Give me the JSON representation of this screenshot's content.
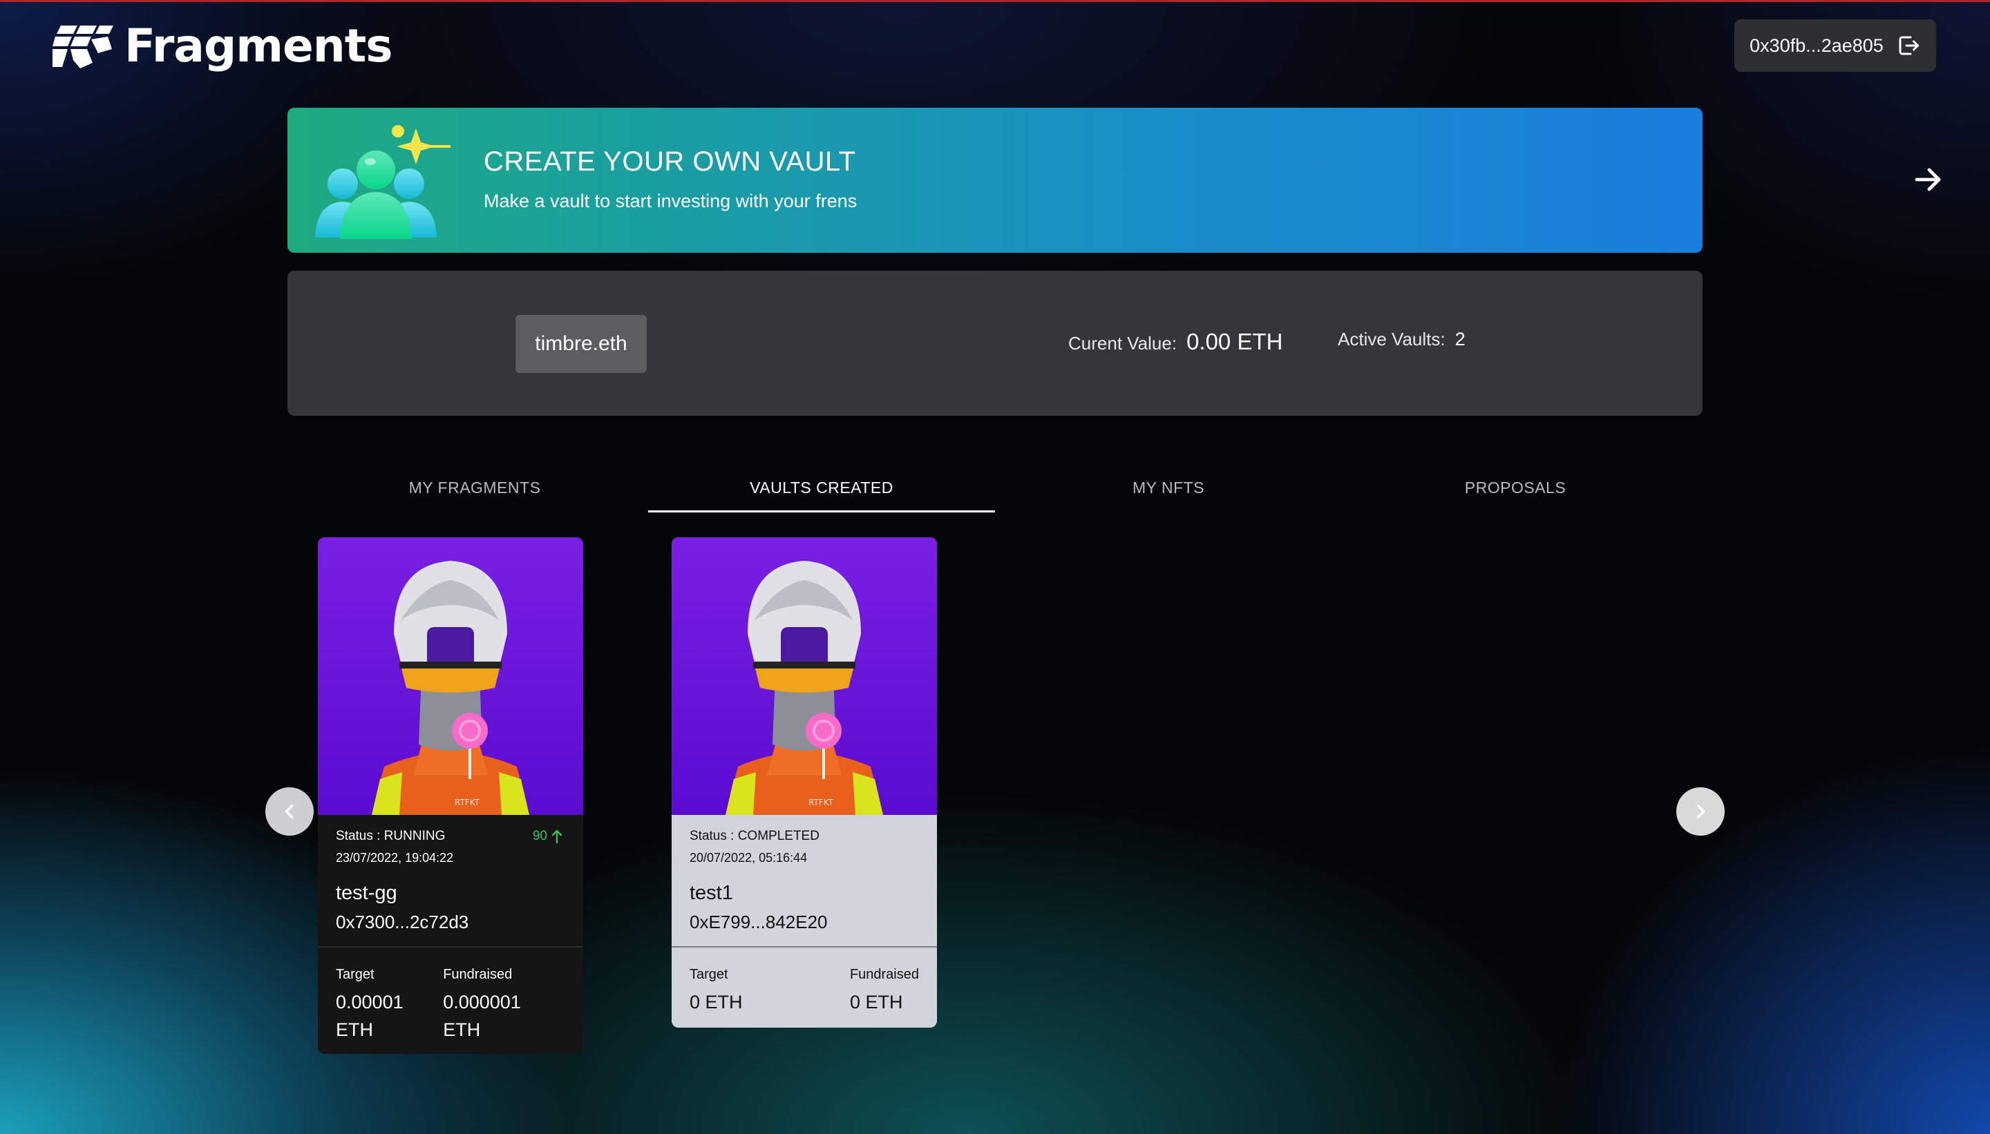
{
  "header": {
    "brand": "Fragments",
    "wallet_address": "0x30fb...2ae805",
    "logout_icon": "logout-icon"
  },
  "banner": {
    "title": "CREATE YOUR OWN VAULT",
    "subtitle": "Make a vault to start investing with your frens",
    "arrow_icon": "arrow-right-icon"
  },
  "stats": {
    "ens_name": "timbre.eth",
    "current_value_label": "Curent Value:",
    "current_value": "0.00 ETH",
    "active_vaults_label": "Active Vaults:",
    "active_vaults": "2"
  },
  "tabs": [
    {
      "label": "MY FRAGMENTS",
      "active": false
    },
    {
      "label": "VAULTS CREATED",
      "active": true
    },
    {
      "label": "MY NFTS",
      "active": false
    },
    {
      "label": "PROPOSALS",
      "active": false
    }
  ],
  "vaults": [
    {
      "status": "Status : RUNNING",
      "date": "23/07/2022, 19:04:22",
      "name": "test-gg",
      "address": "0x7300...2c72d3",
      "delta": "90",
      "target_label": "Target",
      "target_value": "0.00001 ETH",
      "fundraised_label": "Fundraised",
      "fundraised_value": "0.000001 ETH",
      "theme": "dark"
    },
    {
      "status": "Status : COMPLETED",
      "date": "20/07/2022, 05:16:44",
      "name": "test1",
      "address": "0xE799...842E20",
      "target_label": "Target",
      "target_value": "0 ETH",
      "fundraised_label": "Fundraised",
      "fundraised_value": "0 ETH",
      "theme": "light"
    }
  ],
  "colors": {
    "banner_start": "#1faa80",
    "banner_end": "#1a7ede",
    "running_delta": "#3ac25a",
    "nft_background": "#6a14d8",
    "vest_orange": "#e8611c"
  }
}
